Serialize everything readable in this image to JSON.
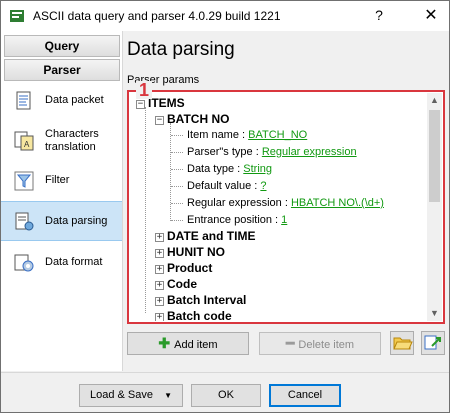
{
  "window": {
    "title": "ASCII data query and parser 4.0.29 build 1221",
    "help": "?",
    "close": "✕"
  },
  "sidebar": {
    "headers": [
      "Query",
      "Parser"
    ],
    "items": [
      {
        "label": "Data packet",
        "icon": "data-packet-icon"
      },
      {
        "label": "Characters",
        "label2": "translation",
        "icon": "characters-translation-icon"
      },
      {
        "label": "Filter",
        "icon": "filter-icon"
      },
      {
        "label": "Data parsing",
        "icon": "data-parsing-icon",
        "active": true
      },
      {
        "label": "Data format",
        "icon": "data-format-icon"
      }
    ]
  },
  "main": {
    "title": "Data parsing",
    "group_label": "Parser params",
    "badge": "1"
  },
  "tree": {
    "root": "ITEMS",
    "batch_no": "BATCH NO",
    "params": [
      {
        "name": "Item name : ",
        "value": "BATCH_NO"
      },
      {
        "name": "Parser\"s type : ",
        "value": "Regular expression"
      },
      {
        "name": "Data type : ",
        "value": "String"
      },
      {
        "name": "Default value : ",
        "value": "?"
      },
      {
        "name": "Regular expression : ",
        "value": "HBATCH NO\\.(\\d+)"
      },
      {
        "name": "Entrance position : ",
        "value": "1"
      }
    ],
    "collapsed": [
      "DATE and TIME",
      "HUNIT NO",
      "Product",
      "Code",
      "Batch Interval",
      "Batch code"
    ]
  },
  "toolbar": {
    "add": "Add item",
    "delete": "Delete item"
  },
  "footer": {
    "load_save": "Load & Save",
    "ok": "OK",
    "cancel": "Cancel"
  }
}
